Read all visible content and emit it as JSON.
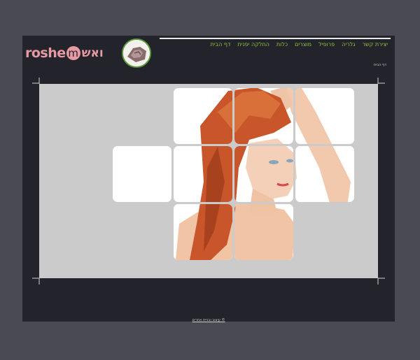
{
  "header": {
    "logo_latin": "roshe",
    "logo_m": "m",
    "logo_hebrew": "ואש"
  },
  "nav": {
    "items": [
      {
        "label": "דף הבית"
      },
      {
        "label": "החלקה יפנית"
      },
      {
        "label": "כלות"
      },
      {
        "label": "מוצרים"
      },
      {
        "label": "פרופיל"
      },
      {
        "label": "גלריה"
      },
      {
        "label": "יצירת קשר"
      }
    ],
    "color": "#8ec83a"
  },
  "breadcrumb": {
    "text": "דף הבית"
  },
  "footer": {
    "link_text": "עיצוב ובניית אתרים ©"
  },
  "colors": {
    "page_bg": "#4a4a55",
    "content_bg": "#23232b",
    "stage_bg": "#cbcbcb",
    "logo_pink": "#e89aa3"
  },
  "gallery": {
    "tiles_visible": 10,
    "image_subject": "red-haired woman photo"
  }
}
